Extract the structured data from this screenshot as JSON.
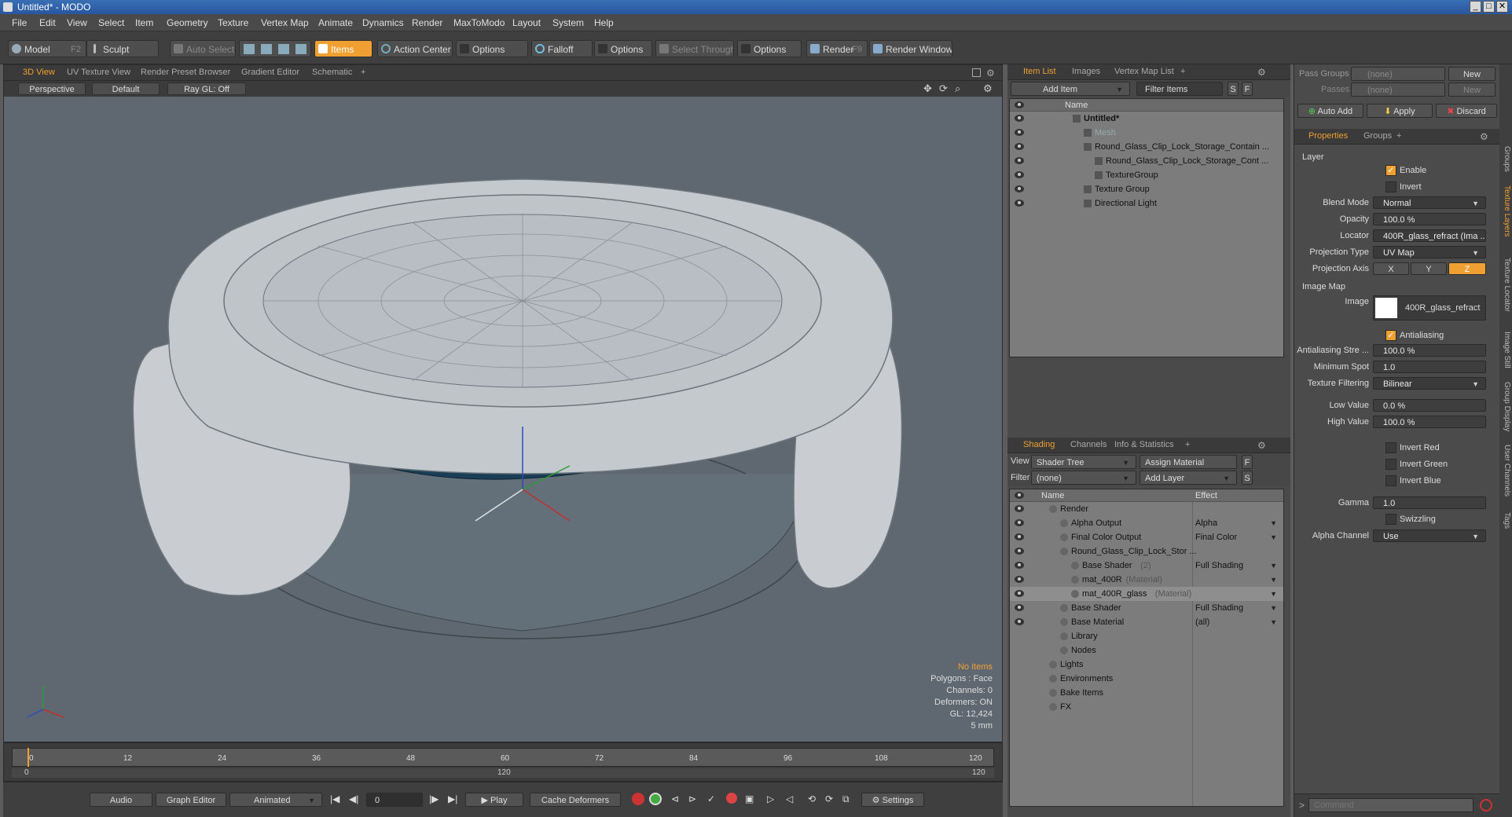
{
  "app": {
    "title": "Untitled* - MODO"
  },
  "menubar": [
    "File",
    "Edit",
    "View",
    "Select",
    "Item",
    "Geometry",
    "Texture",
    "Vertex Map",
    "Animate",
    "Dynamics",
    "Render",
    "MaxToModo",
    "Layout",
    "System",
    "Help"
  ],
  "toolbar": {
    "model": "Model",
    "model_key": "F2",
    "sculpt": "Sculpt",
    "auto_select": "Auto Select",
    "items": "Items",
    "action_center": "Action Center",
    "options1": "Options",
    "falloff": "Falloff",
    "options2": "Options",
    "select_through": "Select Through",
    "options3": "Options",
    "render": "Render",
    "render_key": "F9",
    "render_window": "Render Window"
  },
  "viewport": {
    "tabs": [
      "3D View",
      "UV Texture View",
      "Render Preset Browser",
      "Gradient Editor",
      "Schematic",
      "+"
    ],
    "perspective": "Perspective",
    "default": "Default",
    "raygl": "Ray GL: Off",
    "stats": {
      "no_items": "No Items",
      "polygons": "Polygons : Face",
      "channels": "Channels: 0",
      "deformers": "Deformers: ON",
      "gl": "GL: 12,424",
      "scale": "5 mm"
    }
  },
  "timeline": {
    "ticks": [
      "0",
      "12",
      "24",
      "36",
      "48",
      "60",
      "72",
      "84",
      "96",
      "108",
      "120"
    ],
    "start": "0",
    "mid": "120",
    "end": "120"
  },
  "bottombar": {
    "audio": "Audio",
    "graph_editor": "Graph Editor",
    "animated": "Animated",
    "frame": "0",
    "play": "Play",
    "cache_deformers": "Cache Deformers",
    "settings": "Settings"
  },
  "itemlist": {
    "tabs": [
      "Item List",
      "Images",
      "Vertex Map List",
      "+"
    ],
    "add_item": "Add Item",
    "filter_items": "Filter Items",
    "s": "S",
    "f": "F",
    "col_name": "Name",
    "rows": [
      {
        "label": "Untitled*",
        "indent": 0,
        "bold": true,
        "dim": false
      },
      {
        "label": "Mesh",
        "indent": 1,
        "bold": false,
        "dim": true
      },
      {
        "label": "Round_Glass_Clip_Lock_Storage_Contain ...",
        "indent": 1,
        "bold": false,
        "dim": false
      },
      {
        "label": "Round_Glass_Clip_Lock_Storage_Cont ...",
        "indent": 2,
        "bold": false,
        "dim": false
      },
      {
        "label": "TextureGroup",
        "indent": 2,
        "bold": false,
        "dim": false
      },
      {
        "label": "Texture Group",
        "indent": 1,
        "bold": false,
        "dim": false
      },
      {
        "label": "Directional Light",
        "indent": 1,
        "bold": false,
        "dim": false
      }
    ]
  },
  "shading": {
    "tabs": [
      "Shading",
      "Channels",
      "Info & Statistics",
      "+"
    ],
    "view_label": "View",
    "view_value": "Shader Tree",
    "assign_material": "Assign Material",
    "filter_label": "Filter",
    "filter_value": "(none)",
    "add_layer": "Add Layer",
    "f": "F",
    "s": "S",
    "col_name": "Name",
    "col_effect": "Effect",
    "rows": [
      {
        "label": "Render",
        "sub": "",
        "effect": "",
        "indent": 0
      },
      {
        "label": "Alpha Output",
        "sub": "",
        "effect": "Alpha",
        "indent": 1
      },
      {
        "label": "Final Color Output",
        "sub": "",
        "effect": "Final Color",
        "indent": 1
      },
      {
        "label": "Round_Glass_Clip_Lock_Stor ...",
        "sub": "",
        "effect": "",
        "indent": 1
      },
      {
        "label": "Base Shader",
        "sub": "(2)",
        "effect": "Full Shading",
        "indent": 2
      },
      {
        "label": "mat_400R",
        "sub": "(Material)",
        "effect": "",
        "indent": 2
      },
      {
        "label": "mat_400R_glass",
        "sub": "(Material)",
        "effect": "",
        "indent": 2
      },
      {
        "label": "Base Shader",
        "sub": "",
        "effect": "Full Shading",
        "indent": 1
      },
      {
        "label": "Base Material",
        "sub": "",
        "effect": "(all)",
        "indent": 1
      },
      {
        "label": "Library",
        "sub": "",
        "effect": "",
        "indent": 1
      },
      {
        "label": "Nodes",
        "sub": "",
        "effect": "",
        "indent": 1
      },
      {
        "label": "Lights",
        "sub": "",
        "effect": "",
        "indent": 0
      },
      {
        "label": "Environments",
        "sub": "",
        "effect": "",
        "indent": 0
      },
      {
        "label": "Bake Items",
        "sub": "",
        "effect": "",
        "indent": 0
      },
      {
        "label": "FX",
        "sub": "",
        "effect": "",
        "indent": 0
      }
    ]
  },
  "passes": {
    "pass_groups": "Pass Groups",
    "pass_groups_value": "(none)",
    "new1": "New",
    "passes": "Passes",
    "passes_value": "(none)",
    "new2": "New",
    "auto_add": "Auto Add",
    "apply": "Apply",
    "discard": "Discard"
  },
  "properties": {
    "tabs": [
      "Properties",
      "Groups",
      "+"
    ],
    "layer": "Layer",
    "enable": "Enable",
    "invert": "Invert",
    "blend_mode_label": "Blend Mode",
    "blend_mode": "Normal",
    "opacity_label": "Opacity",
    "opacity": "100.0 %",
    "locator_label": "Locator",
    "locator": "400R_glass_refract (Ima ...",
    "projection_type_label": "Projection Type",
    "projection_type": "UV Map",
    "projection_axis_label": "Projection Axis",
    "axis_x": "X",
    "axis_y": "Y",
    "axis_z": "Z",
    "image_map": "Image Map",
    "image_label": "Image",
    "image": "400R_glass_refract",
    "antialiasing": "Antialiasing",
    "aa_strength_label": "Antialiasing Stre ...",
    "aa_strength": "100.0 %",
    "min_spot_label": "Minimum Spot",
    "min_spot": "1.0",
    "tex_filter_label": "Texture Filtering",
    "tex_filter": "Bilinear",
    "low_label": "Low Value",
    "low": "0.0 %",
    "high_label": "High Value",
    "high": "100.0 %",
    "invert_red": "Invert Red",
    "invert_green": "Invert Green",
    "invert_blue": "Invert Blue",
    "gamma_label": "Gamma",
    "gamma": "1.0",
    "swizzling": "Swizzling",
    "alpha_channel_label": "Alpha Channel",
    "alpha_channel": "Use",
    "command_placeholder": "Command"
  },
  "vtabs": [
    "Groups",
    "Texture Layers",
    "Texture Locator",
    "Image Still",
    "Group Display",
    "User Channels",
    "Tags"
  ],
  "colors": {
    "accent": "#f0a030",
    "titlebar": "#2856a0",
    "viewport_bg": "#5f6870"
  }
}
